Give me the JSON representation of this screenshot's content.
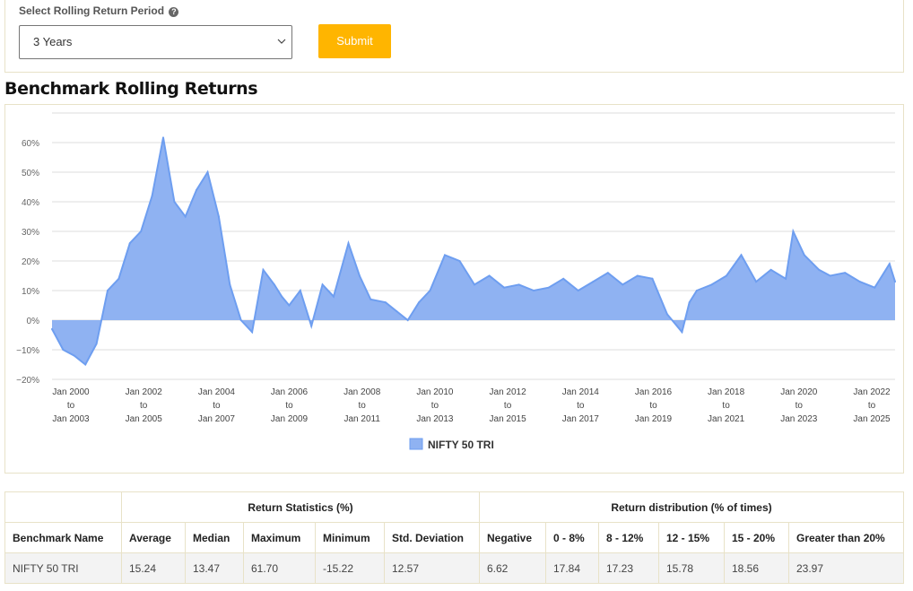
{
  "form": {
    "label": "Select Rolling Return Period",
    "help_icon": "question-circle-icon",
    "selected_period": "3 Years",
    "submit_label": "Submit",
    "accent_color": "#ffb500"
  },
  "section_title": "Benchmark Rolling Returns",
  "chart_data": {
    "type": "area",
    "title": "",
    "xlabel": "",
    "ylabel": "",
    "ylim": [
      -20,
      62
    ],
    "yticks": [
      "60%",
      "50%",
      "40%",
      "30%",
      "20%",
      "10%",
      "0%",
      "−10%",
      "−20%"
    ],
    "xticks": [
      [
        "Jan 2000",
        "to",
        "Jan 2003"
      ],
      [
        "Jan 2002",
        "to",
        "Jan 2005"
      ],
      [
        "Jan 2004",
        "to",
        "Jan 2007"
      ],
      [
        "Jan 2006",
        "to",
        "Jan 2009"
      ],
      [
        "Jan 2008",
        "to",
        "Jan 2011"
      ],
      [
        "Jan 2010",
        "to",
        "Jan 2013"
      ],
      [
        "Jan 2012",
        "to",
        "Jan 2015"
      ],
      [
        "Jan 2014",
        "to",
        "Jan 2017"
      ],
      [
        "Jan 2016",
        "to",
        "Jan 2019"
      ],
      [
        "Jan 2018",
        "to",
        "Jan 2021"
      ],
      [
        "Jan 2020",
        "to",
        "Jan 2023"
      ],
      [
        "Jan 2022",
        "to",
        "Jan 2025"
      ]
    ],
    "grid": true,
    "legend_position": "bottom",
    "series": [
      {
        "name": "NIFTY 50 TRI",
        "color": "#6e9ef0",
        "fill": "#8fb2f2",
        "x": [
          2000.0,
          2000.3,
          2000.6,
          2000.9,
          2001.2,
          2001.5,
          2001.8,
          2002.1,
          2002.4,
          2002.7,
          2003.0,
          2003.3,
          2003.6,
          2003.9,
          2004.2,
          2004.5,
          2004.8,
          2005.1,
          2005.4,
          2005.7,
          2006.0,
          2006.2,
          2006.4,
          2006.7,
          2007.0,
          2007.3,
          2007.6,
          2008.0,
          2008.3,
          2008.6,
          2009.0,
          2009.3,
          2009.6,
          2009.9,
          2010.2,
          2010.6,
          2011.0,
          2011.4,
          2011.8,
          2012.2,
          2012.6,
          2013.0,
          2013.4,
          2013.8,
          2014.2,
          2014.6,
          2015.0,
          2015.4,
          2015.8,
          2016.2,
          2016.6,
          2017.0,
          2017.2,
          2017.4,
          2017.8,
          2018.2,
          2018.6,
          2019.0,
          2019.4,
          2019.8,
          2020.0,
          2020.3,
          2020.7,
          2021.0,
          2021.4,
          2021.8,
          2022.2,
          2022.6,
          2022.75
        ],
        "values": [
          -3,
          -10,
          -12,
          -15,
          -8,
          10,
          14,
          26,
          30,
          42,
          61.7,
          40,
          35,
          44,
          50,
          35,
          12,
          0,
          -4,
          17,
          12,
          8,
          5,
          10,
          -2,
          12,
          8,
          26,
          15,
          7,
          6,
          3,
          0,
          6,
          10,
          22,
          20,
          12,
          15,
          11,
          12,
          10,
          11,
          14,
          10,
          13,
          16,
          12,
          15,
          14,
          2,
          -4,
          6,
          10,
          12,
          15,
          22,
          13,
          17,
          14,
          30,
          22,
          17,
          15,
          16,
          13,
          11,
          19,
          13
        ]
      }
    ]
  },
  "stats_table": {
    "group_headers": [
      "Return Statistics (%)",
      "Return distribution (% of times)"
    ],
    "columns": [
      "Benchmark Name",
      "Average",
      "Median",
      "Maximum",
      "Minimum",
      "Std. Deviation",
      "Negative",
      "0 - 8%",
      "8 - 12%",
      "12 - 15%",
      "15 - 20%",
      "Greater than 20%"
    ],
    "rows": [
      [
        "NIFTY 50 TRI",
        "15.24",
        "13.47",
        "61.70",
        "-15.22",
        "12.57",
        "6.62",
        "17.84",
        "17.23",
        "15.78",
        "18.56",
        "23.97"
      ]
    ]
  }
}
